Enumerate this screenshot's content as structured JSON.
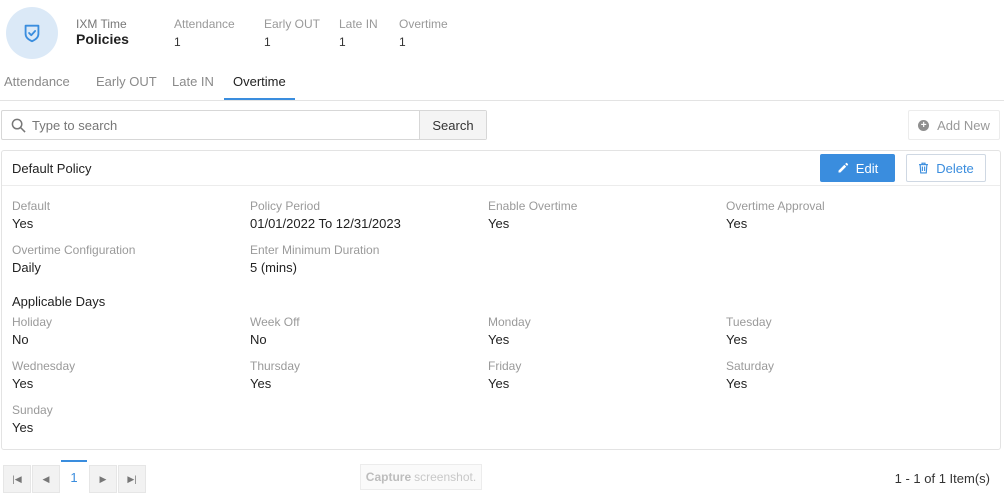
{
  "header": {
    "app_name": "IXM Time",
    "page_title": "Policies",
    "stats": [
      {
        "label": "Attendance",
        "value": "1"
      },
      {
        "label": "Early OUT",
        "value": "1"
      },
      {
        "label": "Late IN",
        "value": "1"
      },
      {
        "label": "Overtime",
        "value": "1"
      }
    ],
    "logo_icon": "shield-check-icon"
  },
  "tabs": [
    {
      "label": "Attendance",
      "active": false
    },
    {
      "label": "Early OUT",
      "active": false
    },
    {
      "label": "Late IN",
      "active": false
    },
    {
      "label": "Overtime",
      "active": true
    }
  ],
  "search": {
    "placeholder": "Type to search",
    "value": "",
    "button_label": "Search"
  },
  "toolbar": {
    "add_new_label": "Add New"
  },
  "policy": {
    "title": "Default Policy",
    "edit_label": "Edit",
    "delete_label": "Delete",
    "fields": [
      {
        "label": "Default",
        "value": "Yes"
      },
      {
        "label": "Policy Period",
        "value": "01/01/2022 To 12/31/2023"
      },
      {
        "label": "Enable Overtime",
        "value": "Yes"
      },
      {
        "label": "Overtime Approval",
        "value": "Yes"
      },
      {
        "label": "Overtime Configuration",
        "value": "Daily"
      },
      {
        "label": "Enter Minimum Duration",
        "value": "5 (mins)"
      }
    ],
    "applicable_days_title": "Applicable Days",
    "days": [
      {
        "label": "Holiday",
        "value": "No"
      },
      {
        "label": "Week Off",
        "value": "No"
      },
      {
        "label": "Monday",
        "value": "Yes"
      },
      {
        "label": "Tuesday",
        "value": "Yes"
      },
      {
        "label": "Wednesday",
        "value": "Yes"
      },
      {
        "label": "Thursday",
        "value": "Yes"
      },
      {
        "label": "Friday",
        "value": "Yes"
      },
      {
        "label": "Saturday",
        "value": "Yes"
      },
      {
        "label": "Sunday",
        "value": "Yes"
      }
    ]
  },
  "pagination": {
    "current_page": "1",
    "info": "1 - 1 of 1 Item(s)"
  },
  "capture_overlay": {
    "bold": "Capture",
    "rest": "screenshot."
  },
  "colors": {
    "accent": "#3a8dde",
    "logo_bg": "#dbe9f7"
  }
}
